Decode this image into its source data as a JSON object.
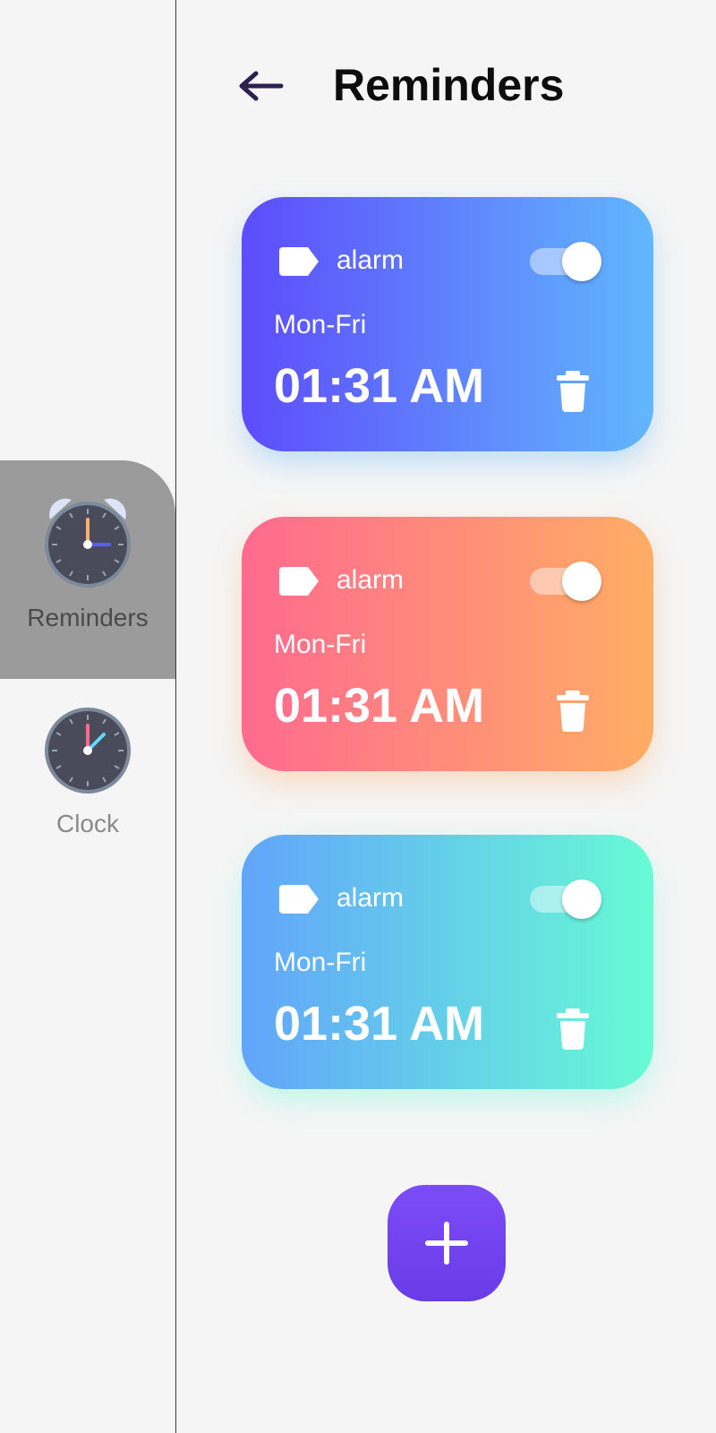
{
  "header": {
    "title": "Reminders",
    "back_icon": "arrow-left-icon"
  },
  "sidebar": {
    "items": [
      {
        "label": "Reminders",
        "icon": "alarm-clock-icon",
        "active": true
      },
      {
        "label": "Clock",
        "icon": "clock-icon",
        "active": false
      }
    ]
  },
  "reminders": [
    {
      "label": "alarm",
      "days": "Mon-Fri",
      "time": "01:31 AM",
      "enabled": true,
      "gradient": [
        "#5d4cfc",
        "#61b7fd"
      ]
    },
    {
      "label": "alarm",
      "days": "Mon-Fri",
      "time": "01:31 AM",
      "enabled": true,
      "gradient": [
        "#ff6a8f",
        "#ffad65"
      ]
    },
    {
      "label": "alarm",
      "days": "Mon-Fri",
      "time": "01:31 AM",
      "enabled": true,
      "gradient": [
        "#62a4fb",
        "#67fbd5"
      ]
    }
  ],
  "add_button": {
    "icon": "plus-icon",
    "color": "#7448f2"
  }
}
